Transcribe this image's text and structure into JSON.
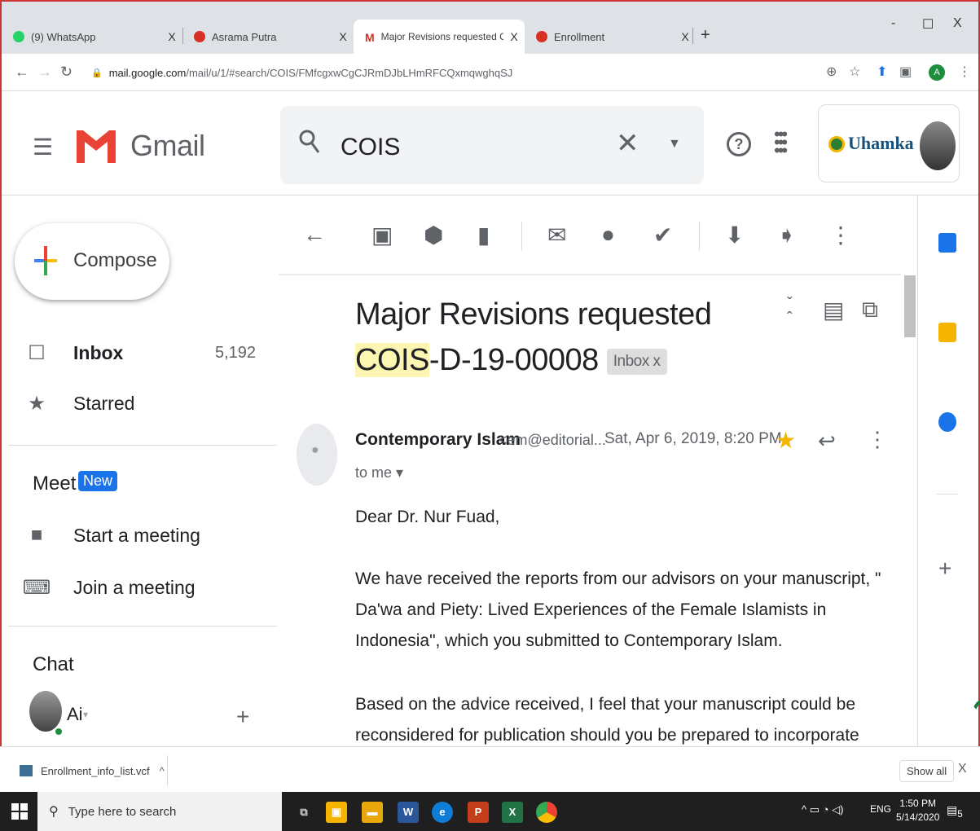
{
  "browser": {
    "tabs": [
      {
        "title": "(9) WhatsApp",
        "favicon_color": "#25d366"
      },
      {
        "title": "Asrama Putra",
        "favicon_color": "#d93025"
      },
      {
        "title": "Major Revisions requested COIS-",
        "favicon_color": "#d93025"
      },
      {
        "title": "Enrollment",
        "favicon_color": "#d93025"
      }
    ],
    "tab_close": "X",
    "new_tab": "+",
    "window_controls": {
      "minimize": "-",
      "maximize": "☐",
      "close": "X"
    },
    "url_host": "mail.google.com",
    "url_path": "/mail/u/1/#search/COIS/FMfcgxwCgCJRmDJbLHmRFCQxmqwghqSJ"
  },
  "gmail": {
    "brand": "Gmail",
    "search_value": "COIS",
    "org_label": "Uhamka",
    "compose_label": "Compose",
    "nav": [
      {
        "label": "Inbox",
        "count": "5,192",
        "icon": "inbox-icon"
      },
      {
        "label": "Starred",
        "icon": "star-icon"
      }
    ],
    "meet": {
      "title": "Meet",
      "badge": "New",
      "items": [
        {
          "label": "Start a meeting",
          "icon": "video-camera-icon"
        },
        {
          "label": "Join a meeting",
          "icon": "keyboard-icon"
        }
      ]
    },
    "chat": {
      "title": "Chat",
      "user": "Ai"
    }
  },
  "message": {
    "subject_prefix": "Major Revisions requested ",
    "subject_highlight": "COIS",
    "subject_suffix": "-D-19-00008",
    "label_chip": "Inbox x",
    "sender_name": "Contemporary Islam",
    "sender_email": "<em@editorial...",
    "date": "Sat, Apr 6, 2019, 8:20 PM",
    "to": "to me ▾",
    "greeting": "Dear Dr. Nur Fuad,",
    "para1": "We have received the reports from our advisors on your manuscript, \" Da'wa and Piety: Lived Experiences of the Female Islamists in Indonesia\", which you submitted to Contemporary Islam.",
    "para2": "Based on the advice received, I feel that your manuscript could be reconsidered for publication should you be prepared to incorporate major revisions.  When preparing"
  },
  "downloads": {
    "file": "Enrollment_info_list.vcf",
    "show_all": "Show all",
    "close": "X"
  },
  "taskbar": {
    "search_placeholder": "Type here to search",
    "lang": "ENG",
    "time": "1:50 PM",
    "date": "5/14/2020",
    "notifications": "5"
  }
}
